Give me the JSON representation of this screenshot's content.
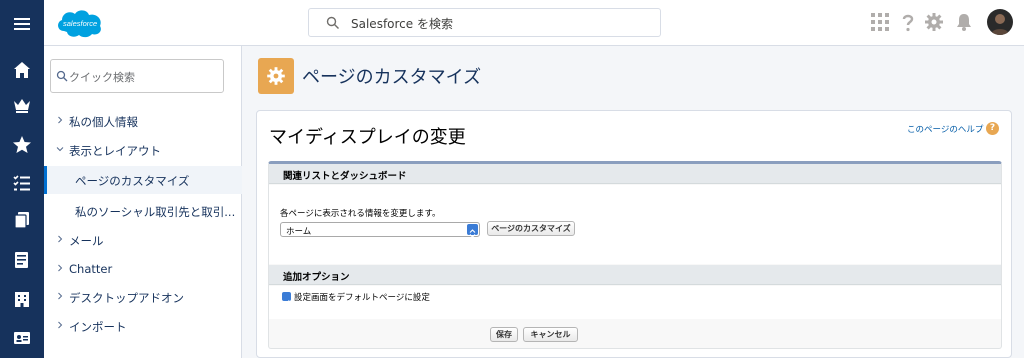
{
  "rail": {
    "items": [
      "menu-icon",
      "home-icon",
      "crown-icon",
      "star-icon",
      "task-list-icon",
      "files-icon",
      "form-icon",
      "building-icon",
      "contact-card-icon"
    ]
  },
  "header": {
    "search_placeholder": "Salesforce を検索",
    "logo_text": "salesforce"
  },
  "sidebar": {
    "quickfind_placeholder": "クイック検索",
    "items": [
      {
        "label": "私の個人情報",
        "chevron": "right"
      },
      {
        "label": "表示とレイアウト",
        "chevron": "down"
      },
      {
        "label": "ページのカスタマイズ",
        "active": true
      },
      {
        "label": "私のソーシャル取引先と取引..."
      },
      {
        "label": "メール",
        "chevron": "right"
      },
      {
        "label": "Chatter",
        "chevron": "right"
      },
      {
        "label": "デスクトップアドオン",
        "chevron": "right"
      },
      {
        "label": "インポート",
        "chevron": "right"
      }
    ]
  },
  "main": {
    "page_title": "ページのカスタマイズ",
    "card_title": "マイディスプレイの変更",
    "help_link": "このページのヘルプ",
    "help_badge": "?",
    "section1": {
      "title": "関連リストとダッシュボード",
      "description": "各ページに表示される情報を変更します。",
      "select_value": "ホーム",
      "button": "ページのカスタマイズ"
    },
    "section2": {
      "title": "追加オプション",
      "checkbox_label": "設定画面をデフォルトページに設定",
      "checked": true
    },
    "save_button": "保存",
    "cancel_button": "キャンセル"
  },
  "colors": {
    "rail": "#16325c",
    "accent": "#0070d2",
    "page_icon": "#e8a752",
    "link": "#015ba7"
  }
}
